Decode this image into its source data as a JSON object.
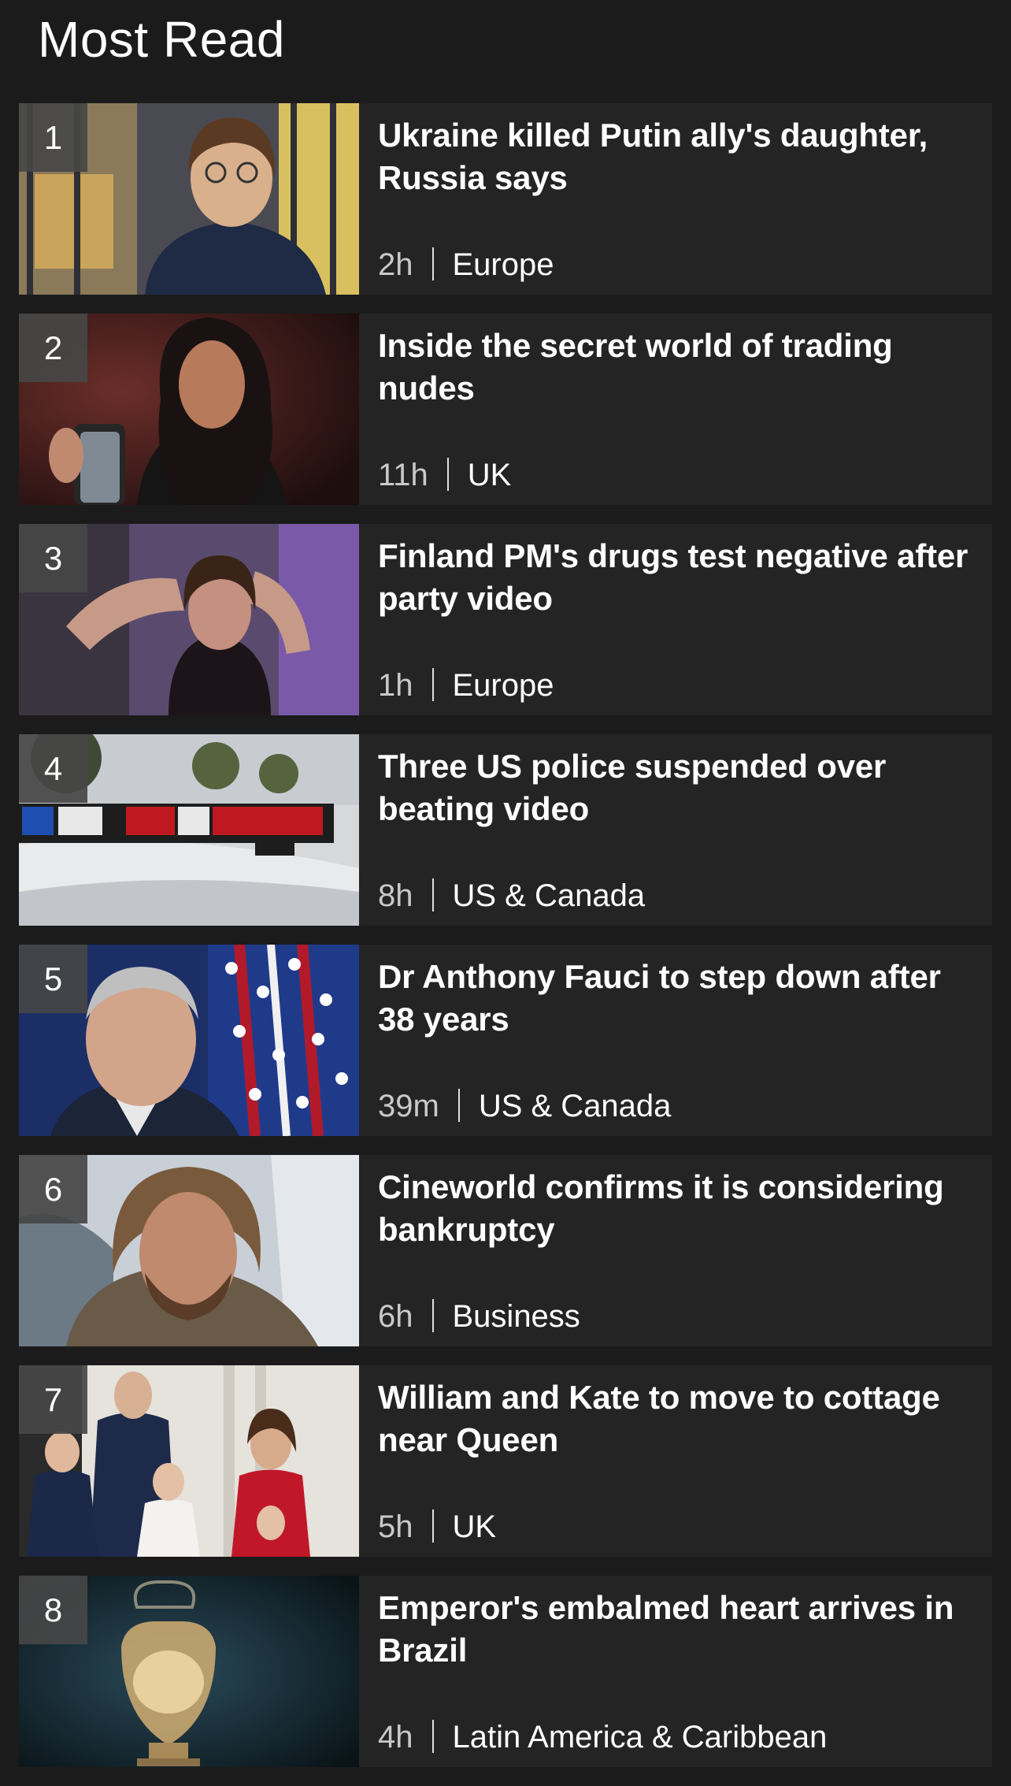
{
  "section": {
    "title": "Most Read"
  },
  "items": [
    {
      "rank": "1",
      "headline": "Ukraine killed Putin ally's daughter, Russia says",
      "time": "2h",
      "category": "Europe"
    },
    {
      "rank": "2",
      "headline": "Inside the secret world of trading nudes",
      "time": "11h",
      "category": "UK"
    },
    {
      "rank": "3",
      "headline": "Finland PM's drugs test negative after party video",
      "time": "1h",
      "category": "Europe"
    },
    {
      "rank": "4",
      "headline": "Three US police suspended over beating video",
      "time": "8h",
      "category": "US & Canada"
    },
    {
      "rank": "5",
      "headline": "Dr Anthony Fauci to step down after 38 years",
      "time": "39m",
      "category": "US & Canada"
    },
    {
      "rank": "6",
      "headline": "Cineworld confirms it is considering bankruptcy",
      "time": "6h",
      "category": "Business"
    },
    {
      "rank": "7",
      "headline": "William and Kate to move to cottage near Queen",
      "time": "5h",
      "category": "UK"
    },
    {
      "rank": "8",
      "headline": "Emperor's embalmed heart arrives in Brazil",
      "time": "4h",
      "category": "Latin America & Caribbean"
    }
  ],
  "colors": {
    "page_background": "#1b1b1b",
    "card_background": "#242424",
    "rank_badge": "#464646",
    "text": "#ffffff",
    "time_text": "#c9c9c9"
  }
}
